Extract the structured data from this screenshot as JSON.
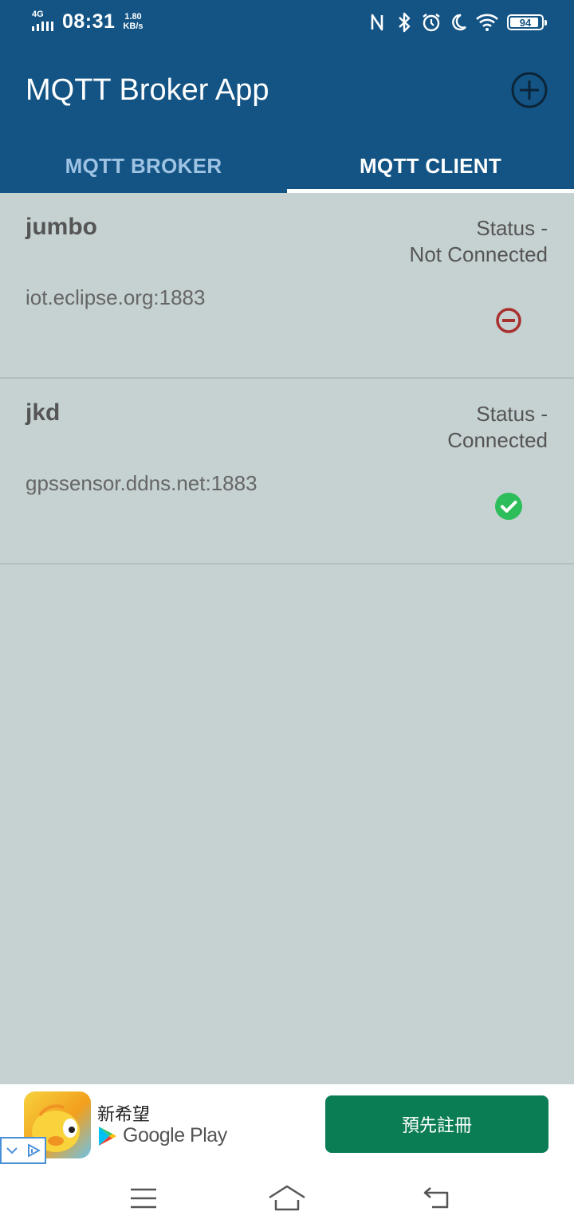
{
  "status_bar": {
    "network": "4G",
    "time": "08:31",
    "speed_value": "1.80",
    "speed_unit": "KB/s",
    "battery": "94"
  },
  "app": {
    "title": "MQTT Broker App"
  },
  "tabs": [
    {
      "label": "MQTT BROKER",
      "active": false
    },
    {
      "label": "MQTT CLIENT",
      "active": true
    }
  ],
  "clients": [
    {
      "name": "jumbo",
      "status_prefix": "Status -",
      "status": "Not Connected",
      "host": "iot.eclipse.org:1883",
      "icon": "disconnected-icon"
    },
    {
      "name": "jkd",
      "status_prefix": "Status -",
      "status": "Connected",
      "host": "gpssensor.ddns.net:1883",
      "icon": "connected-icon"
    }
  ],
  "ad": {
    "app_name": "新希望",
    "store": "Google Play",
    "cta": "預先註冊"
  },
  "colors": {
    "app_bar": "#135485",
    "background": "#c6d1d2",
    "connected": "#2dbd5a",
    "disconnected": "#a8302e",
    "ad_button": "#0b7d55"
  }
}
